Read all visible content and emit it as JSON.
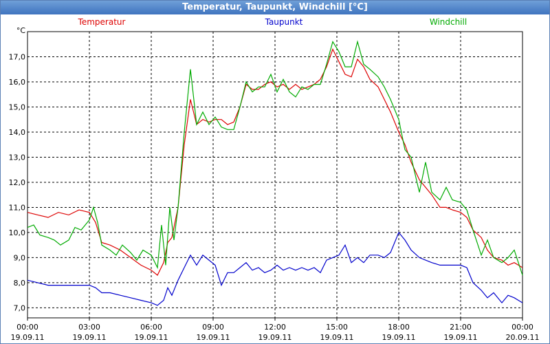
{
  "window": {
    "title": "Temperatur, Taupunkt, Windchill [°C]"
  },
  "chart_data": {
    "type": "line",
    "title": "Temperatur, Taupunkt, Windchill [°C]",
    "ylabel": "°C",
    "ylim": [
      6.6,
      18.0
    ],
    "y_ticks": [
      "7,0",
      "8,0",
      "9,0",
      "10,0",
      "11,0",
      "12,0",
      "13,0",
      "14,0",
      "15,0",
      "16,0",
      "17,0"
    ],
    "x_ticks": [
      {
        "time": "00:00",
        "date": "19.09.11"
      },
      {
        "time": "03:00",
        "date": "19.09.11"
      },
      {
        "time": "06:00",
        "date": "19.09.11"
      },
      {
        "time": "09:00",
        "date": "19.09.11"
      },
      {
        "time": "12:00",
        "date": "19.09.11"
      },
      {
        "time": "15:00",
        "date": "19.09.11"
      },
      {
        "time": "18:00",
        "date": "19.09.11"
      },
      {
        "time": "21:00",
        "date": "19.09.11"
      },
      {
        "time": "00:00",
        "date": "20.09.11"
      }
    ],
    "xlim_hours": [
      0,
      24
    ],
    "grid": true,
    "legend": "top",
    "series": [
      {
        "name": "Temperatur",
        "color": "#dd0000",
        "points": [
          [
            0,
            10.8
          ],
          [
            0.5,
            10.7
          ],
          [
            1,
            10.6
          ],
          [
            1.5,
            10.8
          ],
          [
            2,
            10.7
          ],
          [
            2.5,
            10.9
          ],
          [
            3,
            10.8
          ],
          [
            3.3,
            10.4
          ],
          [
            3.6,
            9.6
          ],
          [
            4,
            9.5
          ],
          [
            4.5,
            9.3
          ],
          [
            5,
            9.0
          ],
          [
            5.5,
            8.7
          ],
          [
            6,
            8.5
          ],
          [
            6.3,
            8.3
          ],
          [
            6.6,
            8.8
          ],
          [
            6.8,
            9.6
          ],
          [
            7.0,
            9.8
          ],
          [
            7.3,
            11.0
          ],
          [
            7.6,
            13.5
          ],
          [
            7.9,
            15.3
          ],
          [
            8.2,
            14.3
          ],
          [
            8.5,
            14.5
          ],
          [
            8.8,
            14.4
          ],
          [
            9.1,
            14.5
          ],
          [
            9.4,
            14.5
          ],
          [
            9.7,
            14.3
          ],
          [
            10.0,
            14.4
          ],
          [
            10.3,
            15.0
          ],
          [
            10.6,
            15.9
          ],
          [
            10.9,
            15.7
          ],
          [
            11.2,
            15.7
          ],
          [
            11.5,
            15.9
          ],
          [
            11.8,
            16.0
          ],
          [
            12.1,
            15.8
          ],
          [
            12.4,
            15.9
          ],
          [
            12.7,
            15.7
          ],
          [
            13.0,
            15.9
          ],
          [
            13.3,
            15.7
          ],
          [
            13.6,
            15.8
          ],
          [
            13.9,
            15.9
          ],
          [
            14.2,
            16.1
          ],
          [
            14.5,
            16.6
          ],
          [
            14.8,
            17.3
          ],
          [
            15.1,
            16.8
          ],
          [
            15.4,
            16.3
          ],
          [
            15.7,
            16.2
          ],
          [
            16.0,
            16.9
          ],
          [
            16.3,
            16.6
          ],
          [
            16.6,
            16.1
          ],
          [
            17.0,
            15.8
          ],
          [
            17.3,
            15.3
          ],
          [
            17.6,
            14.8
          ],
          [
            18.0,
            14.0
          ],
          [
            18.3,
            13.5
          ],
          [
            18.6,
            12.8
          ],
          [
            19.0,
            12.1
          ],
          [
            19.3,
            11.8
          ],
          [
            19.6,
            11.5
          ],
          [
            20.0,
            11.0
          ],
          [
            20.3,
            11.0
          ],
          [
            20.6,
            10.9
          ],
          [
            21.0,
            10.8
          ],
          [
            21.3,
            10.6
          ],
          [
            21.6,
            10.1
          ],
          [
            22.0,
            9.8
          ],
          [
            22.3,
            9.3
          ],
          [
            22.6,
            9.0
          ],
          [
            23.0,
            8.9
          ],
          [
            23.3,
            8.7
          ],
          [
            23.6,
            8.8
          ],
          [
            24.0,
            8.6
          ]
        ]
      },
      {
        "name": "Taupunkt",
        "color": "#0000cc",
        "points": [
          [
            0,
            8.1
          ],
          [
            0.5,
            8.0
          ],
          [
            1,
            7.9
          ],
          [
            1.5,
            7.9
          ],
          [
            2,
            7.9
          ],
          [
            2.5,
            7.9
          ],
          [
            3,
            7.9
          ],
          [
            3.3,
            7.8
          ],
          [
            3.6,
            7.6
          ],
          [
            4,
            7.6
          ],
          [
            4.5,
            7.5
          ],
          [
            5,
            7.4
          ],
          [
            5.5,
            7.3
          ],
          [
            6,
            7.2
          ],
          [
            6.3,
            7.1
          ],
          [
            6.6,
            7.3
          ],
          [
            6.8,
            7.8
          ],
          [
            7.0,
            7.5
          ],
          [
            7.3,
            8.1
          ],
          [
            7.6,
            8.6
          ],
          [
            7.9,
            9.1
          ],
          [
            8.2,
            8.7
          ],
          [
            8.5,
            9.1
          ],
          [
            8.8,
            8.9
          ],
          [
            9.1,
            8.7
          ],
          [
            9.4,
            7.9
          ],
          [
            9.7,
            8.4
          ],
          [
            10.0,
            8.4
          ],
          [
            10.3,
            8.6
          ],
          [
            10.6,
            8.8
          ],
          [
            10.9,
            8.5
          ],
          [
            11.2,
            8.6
          ],
          [
            11.5,
            8.4
          ],
          [
            11.8,
            8.5
          ],
          [
            12.1,
            8.7
          ],
          [
            12.4,
            8.5
          ],
          [
            12.7,
            8.6
          ],
          [
            13.0,
            8.5
          ],
          [
            13.3,
            8.6
          ],
          [
            13.6,
            8.5
          ],
          [
            13.9,
            8.6
          ],
          [
            14.2,
            8.4
          ],
          [
            14.5,
            8.9
          ],
          [
            14.8,
            9.0
          ],
          [
            15.1,
            9.1
          ],
          [
            15.4,
            9.5
          ],
          [
            15.7,
            8.8
          ],
          [
            16.0,
            9.0
          ],
          [
            16.3,
            8.8
          ],
          [
            16.6,
            9.1
          ],
          [
            17.0,
            9.1
          ],
          [
            17.3,
            9.0
          ],
          [
            17.6,
            9.2
          ],
          [
            18.0,
            10.0
          ],
          [
            18.3,
            9.7
          ],
          [
            18.6,
            9.3
          ],
          [
            19.0,
            9.0
          ],
          [
            19.3,
            8.9
          ],
          [
            19.6,
            8.8
          ],
          [
            20.0,
            8.7
          ],
          [
            20.3,
            8.7
          ],
          [
            20.6,
            8.7
          ],
          [
            21.0,
            8.7
          ],
          [
            21.3,
            8.6
          ],
          [
            21.6,
            8.0
          ],
          [
            22.0,
            7.7
          ],
          [
            22.3,
            7.4
          ],
          [
            22.6,
            7.6
          ],
          [
            23.0,
            7.2
          ],
          [
            23.3,
            7.5
          ],
          [
            23.6,
            7.4
          ],
          [
            24.0,
            7.2
          ]
        ]
      },
      {
        "name": "Windchill",
        "color": "#00aa00",
        "points": [
          [
            0,
            10.2
          ],
          [
            0.3,
            10.3
          ],
          [
            0.6,
            9.9
          ],
          [
            1,
            9.8
          ],
          [
            1.3,
            9.7
          ],
          [
            1.6,
            9.5
          ],
          [
            2,
            9.7
          ],
          [
            2.3,
            10.2
          ],
          [
            2.6,
            10.1
          ],
          [
            3.0,
            10.5
          ],
          [
            3.2,
            11.0
          ],
          [
            3.4,
            10.4
          ],
          [
            3.6,
            9.5
          ],
          [
            4,
            9.3
          ],
          [
            4.3,
            9.1
          ],
          [
            4.6,
            9.5
          ],
          [
            5,
            9.2
          ],
          [
            5.3,
            8.9
          ],
          [
            5.6,
            9.3
          ],
          [
            6,
            9.1
          ],
          [
            6.3,
            8.6
          ],
          [
            6.5,
            10.3
          ],
          [
            6.7,
            8.7
          ],
          [
            6.9,
            11.0
          ],
          [
            7.1,
            9.7
          ],
          [
            7.3,
            11.0
          ],
          [
            7.6,
            14.0
          ],
          [
            7.9,
            16.5
          ],
          [
            8.2,
            14.3
          ],
          [
            8.5,
            14.8
          ],
          [
            8.8,
            14.3
          ],
          [
            9.1,
            14.6
          ],
          [
            9.4,
            14.2
          ],
          [
            9.7,
            14.1
          ],
          [
            10.0,
            14.1
          ],
          [
            10.3,
            15.0
          ],
          [
            10.6,
            16.0
          ],
          [
            10.9,
            15.6
          ],
          [
            11.2,
            15.8
          ],
          [
            11.5,
            15.8
          ],
          [
            11.8,
            16.3
          ],
          [
            12.1,
            15.6
          ],
          [
            12.4,
            16.1
          ],
          [
            12.7,
            15.6
          ],
          [
            13.0,
            15.4
          ],
          [
            13.3,
            15.8
          ],
          [
            13.6,
            15.7
          ],
          [
            13.9,
            15.9
          ],
          [
            14.2,
            15.9
          ],
          [
            14.5,
            16.7
          ],
          [
            14.8,
            17.6
          ],
          [
            15.1,
            17.2
          ],
          [
            15.4,
            16.6
          ],
          [
            15.7,
            16.6
          ],
          [
            16.0,
            17.6
          ],
          [
            16.3,
            16.7
          ],
          [
            16.6,
            16.5
          ],
          [
            17.0,
            16.2
          ],
          [
            17.3,
            15.8
          ],
          [
            17.6,
            15.3
          ],
          [
            18.0,
            14.5
          ],
          [
            18.3,
            13.3
          ],
          [
            18.6,
            13.0
          ],
          [
            19.0,
            11.6
          ],
          [
            19.3,
            12.8
          ],
          [
            19.6,
            11.6
          ],
          [
            20.0,
            11.3
          ],
          [
            20.3,
            11.8
          ],
          [
            20.6,
            11.3
          ],
          [
            21.0,
            11.2
          ],
          [
            21.3,
            10.9
          ],
          [
            21.6,
            10.1
          ],
          [
            22.0,
            9.1
          ],
          [
            22.3,
            9.7
          ],
          [
            22.6,
            9.0
          ],
          [
            23.0,
            8.8
          ],
          [
            23.3,
            9.0
          ],
          [
            23.6,
            9.3
          ],
          [
            24.0,
            8.3
          ]
        ]
      }
    ]
  }
}
